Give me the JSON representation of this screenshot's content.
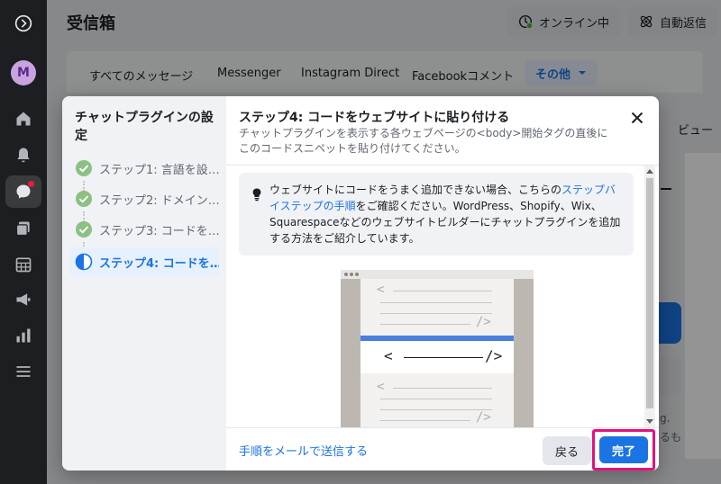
{
  "page": {
    "title": "受信箱",
    "online_label": "オンライン中",
    "auto_reply_label": "自動返信",
    "avatar_letter": "M",
    "tabs": [
      {
        "label": "すべてのメッセージ"
      },
      {
        "label": "Messenger"
      },
      {
        "label": "Instagram Direct"
      },
      {
        "label": "Facebookコメント"
      },
      {
        "label": "その他"
      }
    ],
    "bg_fragments": {
      "view": "ビュー",
      "frag1": "g.",
      "frag2": "るも"
    }
  },
  "modal": {
    "sidebar_title": "チャットプラグインの設定",
    "steps": [
      {
        "label": "ステップ1: 言語を設…",
        "status": "done"
      },
      {
        "label": "ステップ2: ドメイン…",
        "status": "done"
      },
      {
        "label": "ステップ3: コードを…",
        "status": "done"
      },
      {
        "label": "ステップ4: コードを…",
        "status": "active"
      }
    ],
    "title": "ステップ4: コードをウェブサイトに貼り付ける",
    "subtitle": "チャットプラグインを表示する各ウェブページの<body>開始タグの直後にこのコードスニペットを貼り付けてください。",
    "info": {
      "text_before": "ウェブサイトにコードをうまく追加できない場合、こちらの",
      "link": "ステップバイステップの手順",
      "text_after": "をご確認ください。WordPress、Shopify、Wix、Squarespaceなどのウェブサイトビルダーにチャットプラグインを追加する方法をご紹介しています。"
    },
    "illustration": {
      "open_tag": "<",
      "close_tag": "/>",
      "main_open": "<",
      "main_close": "/>"
    },
    "footer": {
      "email_link": "手順をメールで送信する",
      "back": "戻る",
      "done": "完了"
    }
  },
  "colors": {
    "accent": "#1b74e4",
    "highlight": "#e4107c",
    "success": "#8cc084",
    "rail": "#1c1e21"
  }
}
